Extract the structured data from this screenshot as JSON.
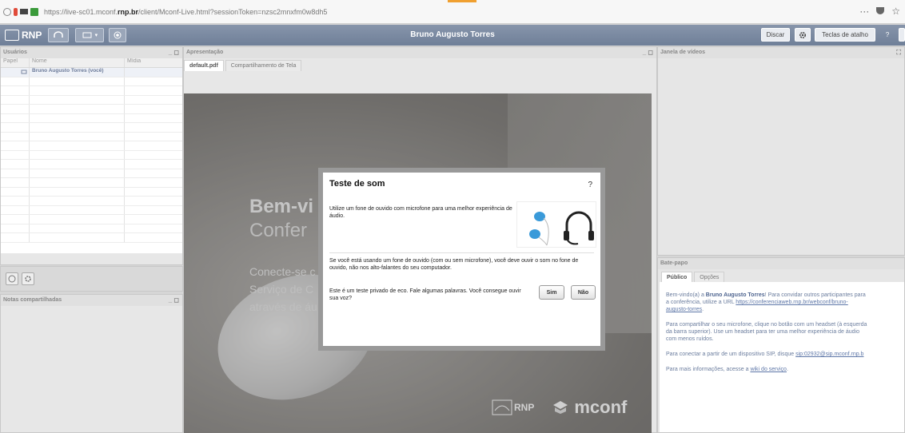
{
  "browser": {
    "url_prefix": "https://live-sc01.mconf.",
    "url_domain": "rnp.br",
    "url_suffix": "/client/Mconf-Live.html?sessionToken=nzsc2mnxfm0w8dh5",
    "menu_icon": "···"
  },
  "app": {
    "logo_text": "RNP",
    "user_name": "Bruno Augusto Torres",
    "btn_discar": "Discar",
    "btn_teclas": "Teclas de atalho",
    "btn_help": "?"
  },
  "users_panel": {
    "title": "Usuários",
    "col_papel": "Papel",
    "col_nome": "Nome",
    "col_midia": "Mídia",
    "users": [
      {
        "name": "Bruno Augusto Torres (você)"
      }
    ]
  },
  "notes_panel": {
    "title": "Notas compartilhadas"
  },
  "presentation": {
    "title": "Apresentação",
    "tabs": [
      {
        "label": "default.pdf"
      },
      {
        "label": "Compartilhamento de Tela"
      }
    ],
    "slide": {
      "line1": "Bem-vi",
      "line2": "Confer",
      "p1": "Conecte-se c",
      "p2": "Serviço de C",
      "p3": "através de áu",
      "logo_rnp": "RNP",
      "logo_mconf": "mconf"
    }
  },
  "video_panel": {
    "title": "Janela de vídeos"
  },
  "dialog": {
    "title": "Teste de som",
    "help": "?",
    "text1": "Utilize um fone de ouvido com microfone para uma melhor experiência de áudio.",
    "text2": "Se você está usando um fone de ouvido (com ou sem microfone), você deve ouvir o som no fone de ouvido, não nos alto-falantes do seu computador.",
    "text3": "Este é um teste privado de eco. Fale algumas palavras. Você consegue ouvir sua voz?",
    "btn_yes": "Sim",
    "btn_no": "Não"
  },
  "chat": {
    "title": "Bate-papo",
    "tabs": [
      {
        "label": "Público"
      },
      {
        "label": "Opções"
      }
    ],
    "m1_a": "Bem-vindo(a) a ",
    "m1_b": "Bruno Augusto Torres",
    "m1_c": "! Para convidar outros participantes para",
    "m1_d": "a conferência, utilize a URL ",
    "m1_e": "https://conferenciaweb.rnp.br/webconf/bruno-",
    "m1_f": "augusto-torres",
    "m1_g": ".",
    "m2_a": "Para compartilhar o seu microfone, clique no botão com um headset (à esquerda",
    "m2_b": "da barra superior). Use um headset para ter uma melhor experiência de áudio",
    "m2_c": "com menos ruídos.",
    "m3_a": "Para conectar a partir de um dispositivo SIP, disque ",
    "m3_b": "sip:02932@sip.mconf.rnp.b",
    "m4_a": "Para mais informações, acesse a ",
    "m4_b": "wiki do serviço",
    "m4_c": "."
  }
}
